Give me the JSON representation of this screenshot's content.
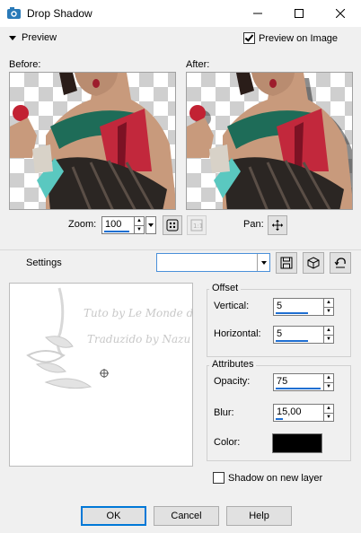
{
  "window": {
    "title": "Drop Shadow",
    "controls": {
      "minimize": "–",
      "maximize": "☐",
      "close": "✕"
    }
  },
  "preview": {
    "toggle_label": "Preview",
    "preview_on_image_label": "Preview on Image",
    "preview_on_image_checked": true,
    "before_label": "Before:",
    "after_label": "After:"
  },
  "zoom": {
    "label": "Zoom:",
    "value": "100"
  },
  "pan": {
    "label": "Pan:"
  },
  "settings": {
    "label": "Settings",
    "preset_value": ""
  },
  "watermark": {
    "line1": "Tuto by Le Monde de Bea",
    "line2": "Traduzido by Nazu Nobais"
  },
  "offset": {
    "title": "Offset",
    "vertical_label": "Vertical:",
    "vertical_value": "5",
    "horizontal_label": "Horizontal:",
    "horizontal_value": "5"
  },
  "attributes": {
    "title": "Attributes",
    "opacity_label": "Opacity:",
    "opacity_value": "75",
    "blur_label": "Blur:",
    "blur_value": "15,00",
    "color_label": "Color:",
    "color_hex": "#000000"
  },
  "shadow_new_layer": {
    "label": "Shadow on new layer",
    "checked": false
  },
  "buttons": {
    "ok": "OK",
    "cancel": "Cancel",
    "help": "Help"
  },
  "colors": {
    "accent": "#0078d7",
    "slider": "#1f6fd1"
  }
}
